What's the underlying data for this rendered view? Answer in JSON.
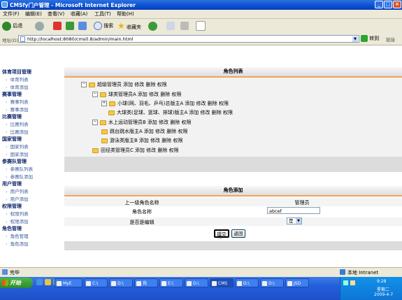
{
  "window": {
    "title": "CMSfy门户管理 - Microsoft Internet Explorer"
  },
  "menu": [
    "文件(F)",
    "编辑(E)",
    "查看(V)",
    "收藏(A)",
    "工具(T)",
    "帮助(H)"
  ],
  "toolbar": {
    "back": "后退",
    "search": "搜索",
    "favorites": "收藏夹"
  },
  "address": {
    "label": "地址(D)",
    "url": "http://localhost:8080/cms0.8/admin/main.html",
    "go": "转到",
    "links": "链接"
  },
  "sidebar": [
    {
      "title": "体育项目管理",
      "items": [
        "体育列表",
        "体育添加"
      ]
    },
    {
      "title": "赛事管理",
      "items": [
        "赛事列表",
        "赛事添加"
      ]
    },
    {
      "title": "比赛管理",
      "items": [
        "比赛列表",
        "比赛添加"
      ]
    },
    {
      "title": "国家管理",
      "items": [
        "国家列表",
        "国家添加"
      ]
    },
    {
      "title": "参赛队管理",
      "items": [
        "参赛队列表",
        "参赛队添加"
      ]
    },
    {
      "title": "用户管理",
      "items": [
        "用户列表",
        "用户添加"
      ]
    },
    {
      "title": "权限管理",
      "items": [
        "权限列表",
        "权限添加"
      ]
    },
    {
      "title": "角色管理",
      "items": [
        "角色管理",
        "角色添加"
      ]
    }
  ],
  "role_list": {
    "title": "角色列表",
    "actions": "添加 修改 删除 权限",
    "nodes": [
      {
        "name": "超级管理员"
      },
      {
        "name": "球类管理员A"
      },
      {
        "name": "小球(网、羽毛、乒乓)总版主A"
      },
      {
        "name": "大球类(足球、篮球、排球)版主A"
      },
      {
        "name": "水上运动管理员B"
      },
      {
        "name": "跳台跳水版主A"
      },
      {
        "name": "游泳类版主B"
      },
      {
        "name": "田径类管理员C"
      }
    ]
  },
  "role_add": {
    "title": "角色添加",
    "parent_label": "上一级角色名称",
    "parent_value": "管理员",
    "name_label": "角色名称",
    "name_value": "abcef",
    "editable_label": "是否是编辑",
    "editable_value": "是",
    "submit": "提交",
    "back": "返回"
  },
  "status": {
    "left": "完毕",
    "zone": "本地 Intranet"
  },
  "taskbar": {
    "start": "开始",
    "tasks": [
      "MyE",
      "C:\\",
      "D:\\",
      "我",
      "E:\\",
      "D:\\",
      "CMS",
      "D:\\",
      "D:\\",
      "JSD"
    ],
    "time": "9:28",
    "weekday": "星期二",
    "date": "2009-4-7"
  }
}
